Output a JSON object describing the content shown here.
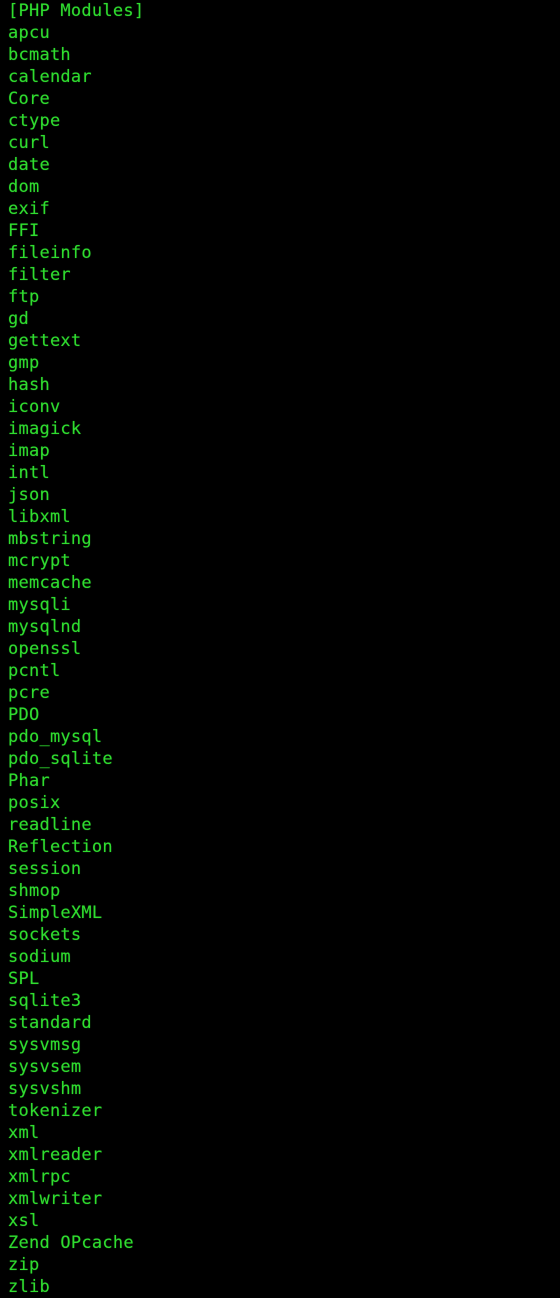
{
  "terminal": {
    "background_color": "#000000",
    "text_color": "#2fdc2f",
    "header": "[PHP Modules]",
    "modules": [
      "apcu",
      "bcmath",
      "calendar",
      "Core",
      "ctype",
      "curl",
      "date",
      "dom",
      "exif",
      "FFI",
      "fileinfo",
      "filter",
      "ftp",
      "gd",
      "gettext",
      "gmp",
      "hash",
      "iconv",
      "imagick",
      "imap",
      "intl",
      "json",
      "libxml",
      "mbstring",
      "mcrypt",
      "memcache",
      "mysqli",
      "mysqlnd",
      "openssl",
      "pcntl",
      "pcre",
      "PDO",
      "pdo_mysql",
      "pdo_sqlite",
      "Phar",
      "posix",
      "readline",
      "Reflection",
      "session",
      "shmop",
      "SimpleXML",
      "sockets",
      "sodium",
      "SPL",
      "sqlite3",
      "standard",
      "sysvmsg",
      "sysvsem",
      "sysvshm",
      "tokenizer",
      "xml",
      "xmlreader",
      "xmlrpc",
      "xmlwriter",
      "xsl",
      "Zend OPcache",
      "zip",
      "zlib"
    ]
  }
}
